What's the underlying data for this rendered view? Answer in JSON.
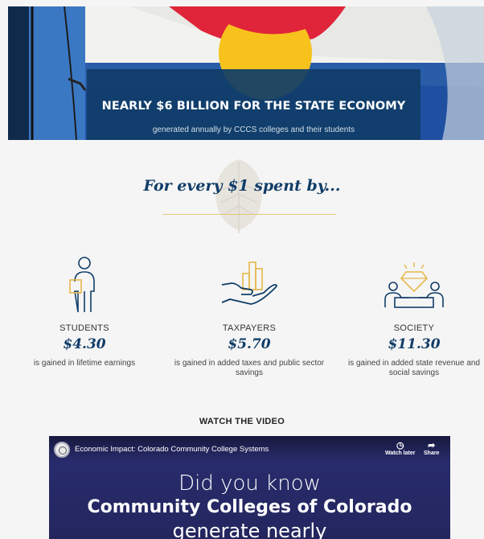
{
  "hero": {
    "title": "NEARLY $6 BILLION FOR THE STATE ECONOMY",
    "subtitle": "generated annually by CCCS colleges and their students"
  },
  "intro": {
    "heading": "For every $1 spent by..."
  },
  "stats": [
    {
      "icon": "student-icon",
      "category": "STUDENTS",
      "amount": "$4.30",
      "description": "is gained in lifetime earnings"
    },
    {
      "icon": "taxpayer-hand-icon",
      "category": "TAXPAYERS",
      "amount": "$5.70",
      "description": "is gained in added taxes and public sector savings"
    },
    {
      "icon": "society-icon",
      "category": "SOCIETY",
      "amount": "$11.30",
      "description": "is gained in added state revenue and social savings"
    }
  ],
  "video": {
    "section_title": "WATCH THE VIDEO",
    "title": "Economic Impact: Colorado Community College Systems",
    "watch_later": "Watch later",
    "share": "Share",
    "line1": "Did you know",
    "line2": "Community Colleges of Colorado",
    "line3": "generate nearly"
  },
  "colors": {
    "navy": "#103d68",
    "gold": "#e6b84a",
    "flag_red": "#e0243a",
    "flag_blue": "#1f4fa0"
  }
}
